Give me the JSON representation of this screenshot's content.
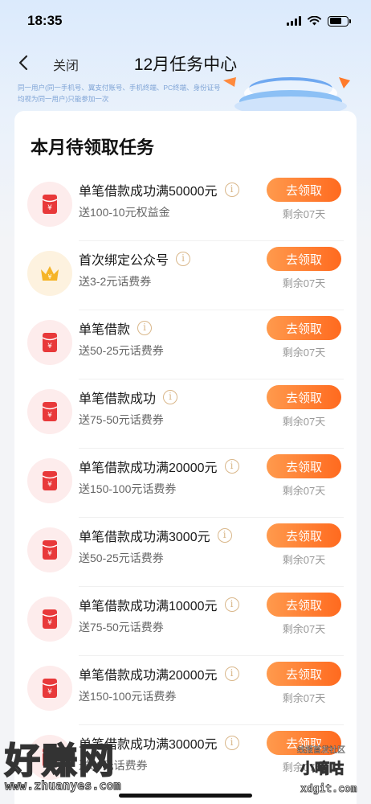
{
  "status_bar": {
    "time": "18:35"
  },
  "nav": {
    "close_label": "关闭",
    "title": "12月任务中心"
  },
  "notice": {
    "text": "同一用户(同一手机号、翼支付账号、手机终端、PC终端、身份证号均视为同一用户)只能参加一次"
  },
  "card": {
    "title": "本月待领取任务",
    "tasks": [
      {
        "name": "单笔借款成功满50000元",
        "reward": "送100-10元权益金",
        "button": "去领取",
        "days_left": "剩余07天",
        "icon": "red-envelope-icon"
      },
      {
        "name": "首次绑定公众号",
        "reward": "送3-2元话费券",
        "button": "去领取",
        "days_left": "剩余07天",
        "icon": "crown-icon"
      },
      {
        "name": "单笔借款",
        "reward": "送50-25元话费券",
        "button": "去领取",
        "days_left": "剩余07天",
        "icon": "red-envelope-icon"
      },
      {
        "name": "单笔借款成功",
        "reward": "送75-50元话费券",
        "button": "去领取",
        "days_left": "剩余07天",
        "icon": "red-envelope-icon"
      },
      {
        "name": "单笔借款成功满20000元",
        "reward": "送150-100元话费券",
        "button": "去领取",
        "days_left": "剩余07天",
        "icon": "red-envelope-icon"
      },
      {
        "name": "单笔借款成功满3000元",
        "reward": "送50-25元话费券",
        "button": "去领取",
        "days_left": "剩余07天",
        "icon": "red-envelope-icon"
      },
      {
        "name": "单笔借款成功满10000元",
        "reward": "送75-50元话费券",
        "button": "去领取",
        "days_left": "剩余07天",
        "icon": "red-envelope-icon"
      },
      {
        "name": "单笔借款成功满20000元",
        "reward": "送150-100元话费券",
        "button": "去领取",
        "days_left": "剩余07天",
        "icon": "red-envelope-icon"
      },
      {
        "name": "单笔借款成功满30000元",
        "reward": "送50元话费券",
        "button": "去领取",
        "days_left": "剩余07天",
        "icon": "red-envelope-icon"
      }
    ]
  },
  "watermarks": {
    "left_brand": "好赚网",
    "left_url": "www.zhuanyes.com",
    "right_top": "线报首发社区",
    "right_brand": "小嘀咕",
    "right_url": "xdgit.com"
  },
  "colors": {
    "accent": "#ff6a1f",
    "accent_light": "#ff9a4d",
    "icon_red": "#e8393a",
    "icon_gold": "#f5b428"
  }
}
